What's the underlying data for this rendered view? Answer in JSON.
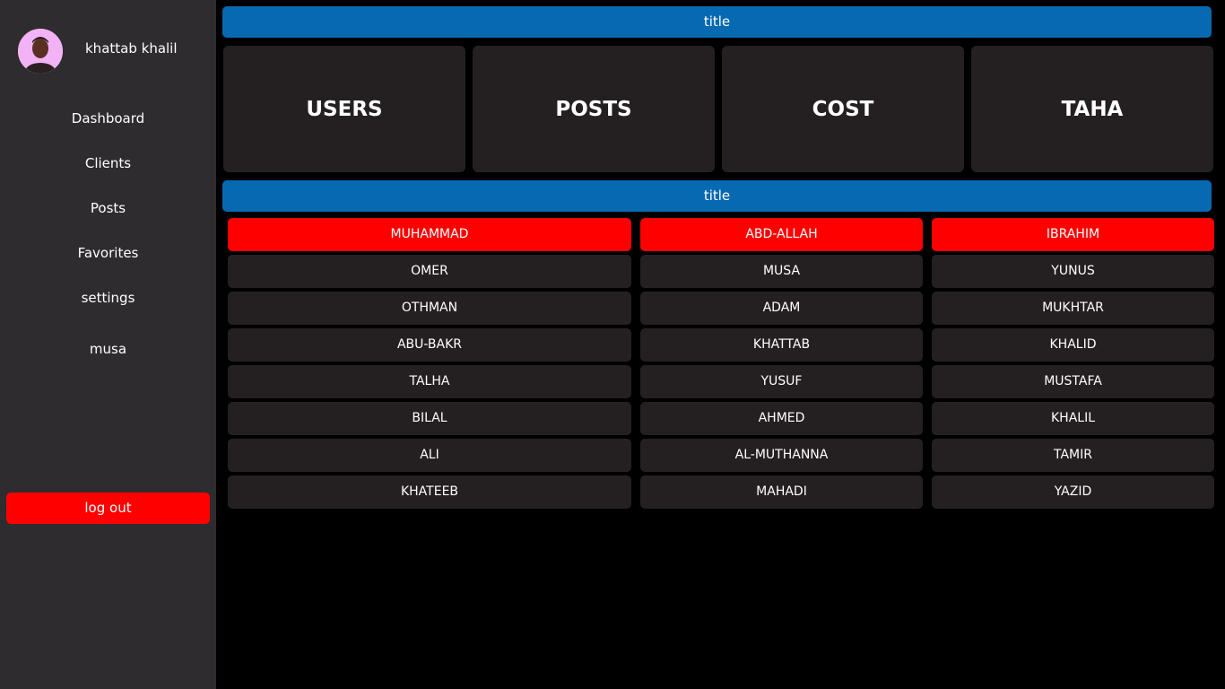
{
  "sidebar": {
    "profile_name": "khattab khalil",
    "nav": [
      "Dashboard",
      "Clients",
      "Posts",
      "Favorites",
      "settings",
      "musa"
    ],
    "logout_label": "log out"
  },
  "main": {
    "title_top": "title",
    "title_bottom": "title",
    "cards": [
      "USERS",
      "POSTS",
      "COST",
      "TAHA"
    ],
    "table": {
      "headers": [
        "MUHAMMAD",
        "ABD-ALLAH",
        "IBRAHIM"
      ],
      "rows": [
        [
          "OMER",
          "MUSA",
          "YUNUS"
        ],
        [
          "OTHMAN",
          "ADAM",
          "MUKHTAR"
        ],
        [
          "ABU-BAKR",
          "KHATTAB",
          "KHALID"
        ],
        [
          "TALHA",
          "YUSUF",
          "MUSTAFA"
        ],
        [
          "BILAL",
          "AHMED",
          "KHALIL"
        ],
        [
          "ALI",
          "AL-MUTHANNA",
          "TAMIR"
        ],
        [
          "KHATEEB",
          "MAHADI",
          "YAZID"
        ]
      ]
    }
  },
  "colors": {
    "sidebar_bg": "#2e2c2e",
    "title_bar": "#0769b1",
    "card_bg": "#242021",
    "accent_red": "#ff0000",
    "page_bg": "#000000"
  }
}
